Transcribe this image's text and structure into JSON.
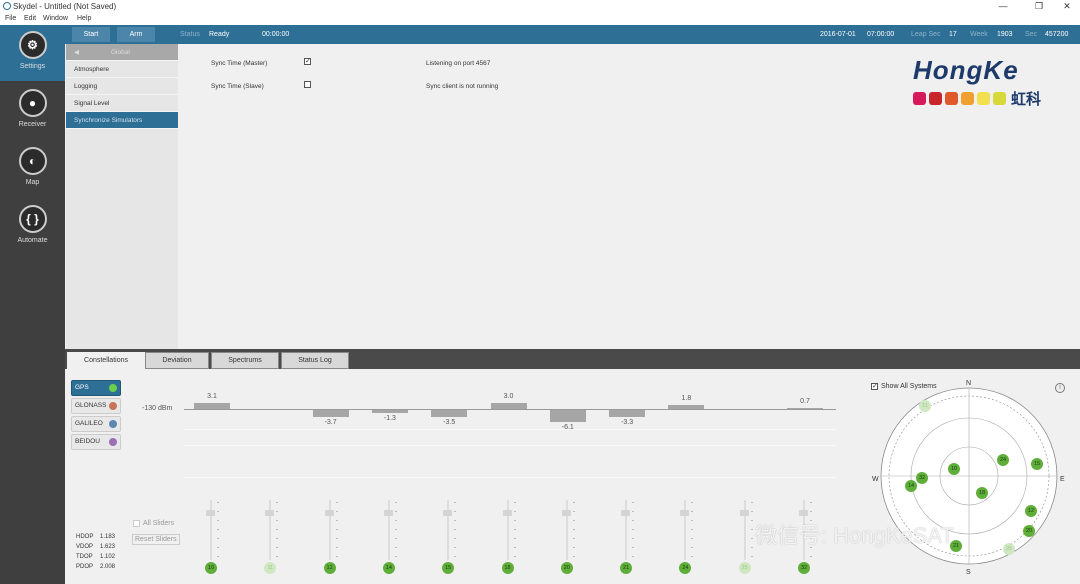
{
  "window": {
    "title": "Skydel - Untitled (Not Saved)",
    "controls": [
      "—",
      "❐",
      "✕"
    ]
  },
  "menu": [
    "File",
    "Edit",
    "Window",
    "Help"
  ],
  "sidebar": [
    {
      "label": "Settings",
      "icon": "gear-icon",
      "glyph": "⚙"
    },
    {
      "label": "Receiver",
      "icon": "location-pin-icon",
      "glyph": "●"
    },
    {
      "label": "Map",
      "icon": "globe-icon",
      "glyph": "◐"
    },
    {
      "label": "Automate",
      "icon": "braces-icon",
      "glyph": "{ }"
    }
  ],
  "topbar": {
    "start": "Start",
    "arm": "Arm",
    "status_label": "Status",
    "status": "Ready",
    "elapsed": "00:00:00",
    "date": "2016-07-01",
    "time": "07:00:00",
    "leap_label": "Leap Sec",
    "leap": "17",
    "week_label": "Week",
    "week": "1903",
    "sec_label": "Sec",
    "sec": "457200"
  },
  "submenu": {
    "header": "Global",
    "items": [
      "Atmosphere",
      "Logging",
      "Signal Level",
      "Synchronize Simulators"
    ],
    "selected": 3
  },
  "sync": {
    "master_label": "Sync Time (Master)",
    "master_checked": true,
    "master_status": "Listening on port 4567",
    "slave_label": "Sync Time (Slave)",
    "slave_checked": false,
    "slave_status": "Sync client is not running"
  },
  "logo": {
    "text": "HongKe",
    "cn": "虹科",
    "colors": [
      "#d6195a",
      "#c8262d",
      "#e0592a",
      "#f0a030",
      "#f2e050",
      "#d7d93a"
    ]
  },
  "tabs": [
    "Constellations",
    "Deviation",
    "Spectrums",
    "Status Log"
  ],
  "active_tab": 0,
  "constellations": [
    {
      "label": "GPS",
      "color": "#6ad04a",
      "active": true
    },
    {
      "label": "GLONASS",
      "color": "#c87458"
    },
    {
      "label": "GALILEO",
      "color": "#5d86b0"
    },
    {
      "label": "BEIDOU",
      "color": "#9a6fb4"
    }
  ],
  "reference_label": "-130 dBm",
  "all_sliders": "All Sliders",
  "reset_sliders": "Reset Sliders",
  "dop": [
    {
      "label": "HDOP",
      "value": "1.183"
    },
    {
      "label": "VDOP",
      "value": "1.623"
    },
    {
      "label": "TDOP",
      "value": "1.102"
    },
    {
      "label": "PDOP",
      "value": "2.008"
    }
  ],
  "satellites": [
    {
      "prn": "10",
      "offset": 3.1,
      "label": "3.1",
      "visible": true
    },
    {
      "prn": "11",
      "offset": null,
      "label": "",
      "visible": false
    },
    {
      "prn": "12",
      "offset": -3.7,
      "label": "-3.7",
      "visible": true
    },
    {
      "prn": "14",
      "offset": -1.3,
      "label": "-1.3",
      "visible": true
    },
    {
      "prn": "15",
      "offset": -3.5,
      "label": "-3.5",
      "visible": true
    },
    {
      "prn": "18",
      "offset": 3.0,
      "label": "3.0",
      "visible": true
    },
    {
      "prn": "20",
      "offset": -6.1,
      "label": "-6.1",
      "visible": true
    },
    {
      "prn": "21",
      "offset": -3.3,
      "label": "-3.3",
      "visible": true
    },
    {
      "prn": "24",
      "offset": 1.8,
      "label": "1.8",
      "visible": true
    },
    {
      "prn": "25",
      "offset": null,
      "label": "",
      "visible": false
    },
    {
      "prn": "32",
      "offset": 0.7,
      "label": "0.7",
      "visible": true
    }
  ],
  "skyplot": {
    "show_all": "Show All Systems",
    "show_all_checked": true,
    "north": "N",
    "south": "S",
    "east": "E",
    "west": "W",
    "info_icon": "info-icon"
  },
  "watermark": "微信号: HongKeSAT"
}
